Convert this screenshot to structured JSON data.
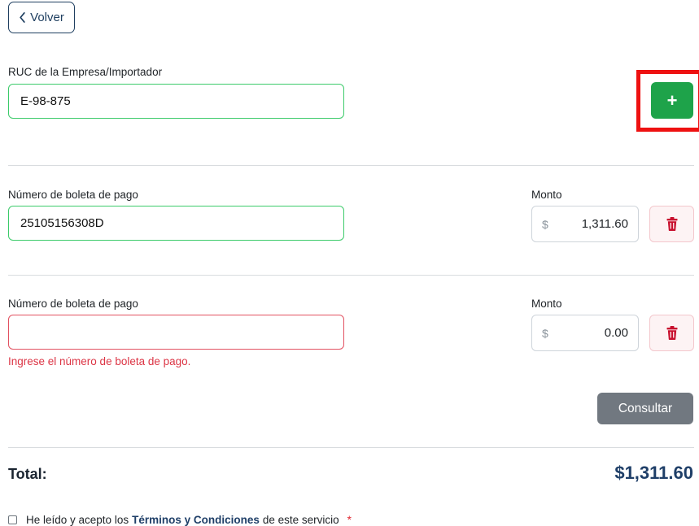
{
  "back_button": {
    "label": "Volver"
  },
  "ruc": {
    "label": "RUC de la Empresa/Importador",
    "value": "E-98-875"
  },
  "add_button": {
    "label": "+"
  },
  "rows": [
    {
      "label": "Número de boleta de pago",
      "value": "25105156308D",
      "amount_label": "Monto",
      "currency": "$",
      "amount": "1,311.60",
      "error": ""
    },
    {
      "label": "Número de boleta de pago",
      "value": "",
      "amount_label": "Monto",
      "currency": "$",
      "amount": "0.00",
      "error": "Ingrese el número de boleta de pago."
    }
  ],
  "consult_button": {
    "label": "Consultar"
  },
  "total": {
    "label": "Total:",
    "value": "$1,311.60"
  },
  "terms": {
    "prefix": "He leído y acepto los",
    "link": "Términos y Condiciones",
    "suffix": "de este servicio",
    "required_mark": "*"
  },
  "colors": {
    "primary": "#1f3f68",
    "success": "#1ea34a",
    "danger": "#dc3545",
    "secondary": "#717880",
    "highlight": "#ee1111"
  }
}
